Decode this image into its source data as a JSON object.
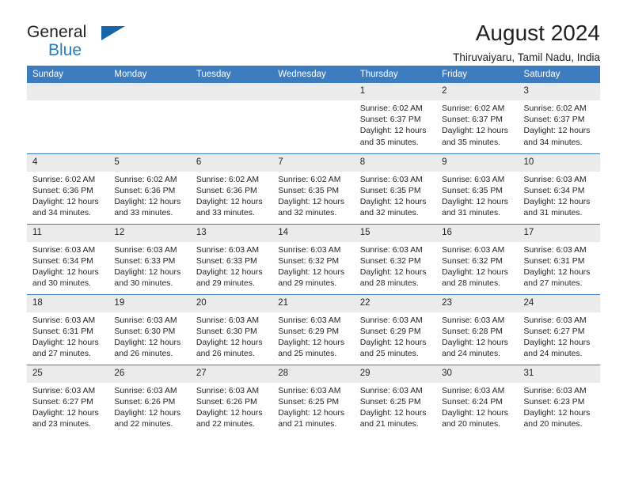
{
  "brand": {
    "name_part1": "General",
    "name_part2": "Blue",
    "flag_icon": "triangle-flag-icon"
  },
  "header": {
    "title": "August 2024",
    "location": "Thiruvaiyaru, Tamil Nadu, India"
  },
  "theme": {
    "header_blue": "#3c7cbf",
    "brand_blue": "#1f7fc4",
    "daynum_gray": "#ebebeb",
    "text": "#231f20"
  },
  "weekday_headers": [
    "Sunday",
    "Monday",
    "Tuesday",
    "Wednesday",
    "Thursday",
    "Friday",
    "Saturday"
  ],
  "weeks": [
    [
      {
        "day": "",
        "blank": true,
        "sunrise": "",
        "sunset": "",
        "daylight1": "",
        "daylight2": ""
      },
      {
        "day": "",
        "blank": true,
        "sunrise": "",
        "sunset": "",
        "daylight1": "",
        "daylight2": ""
      },
      {
        "day": "",
        "blank": true,
        "sunrise": "",
        "sunset": "",
        "daylight1": "",
        "daylight2": ""
      },
      {
        "day": "",
        "blank": true,
        "sunrise": "",
        "sunset": "",
        "daylight1": "",
        "daylight2": ""
      },
      {
        "day": "1",
        "blank": false,
        "sunrise": "Sunrise: 6:02 AM",
        "sunset": "Sunset: 6:37 PM",
        "daylight1": "Daylight: 12 hours",
        "daylight2": "and 35 minutes."
      },
      {
        "day": "2",
        "blank": false,
        "sunrise": "Sunrise: 6:02 AM",
        "sunset": "Sunset: 6:37 PM",
        "daylight1": "Daylight: 12 hours",
        "daylight2": "and 35 minutes."
      },
      {
        "day": "3",
        "blank": false,
        "sunrise": "Sunrise: 6:02 AM",
        "sunset": "Sunset: 6:37 PM",
        "daylight1": "Daylight: 12 hours",
        "daylight2": "and 34 minutes."
      }
    ],
    [
      {
        "day": "4",
        "blank": false,
        "sunrise": "Sunrise: 6:02 AM",
        "sunset": "Sunset: 6:36 PM",
        "daylight1": "Daylight: 12 hours",
        "daylight2": "and 34 minutes."
      },
      {
        "day": "5",
        "blank": false,
        "sunrise": "Sunrise: 6:02 AM",
        "sunset": "Sunset: 6:36 PM",
        "daylight1": "Daylight: 12 hours",
        "daylight2": "and 33 minutes."
      },
      {
        "day": "6",
        "blank": false,
        "sunrise": "Sunrise: 6:02 AM",
        "sunset": "Sunset: 6:36 PM",
        "daylight1": "Daylight: 12 hours",
        "daylight2": "and 33 minutes."
      },
      {
        "day": "7",
        "blank": false,
        "sunrise": "Sunrise: 6:02 AM",
        "sunset": "Sunset: 6:35 PM",
        "daylight1": "Daylight: 12 hours",
        "daylight2": "and 32 minutes."
      },
      {
        "day": "8",
        "blank": false,
        "sunrise": "Sunrise: 6:03 AM",
        "sunset": "Sunset: 6:35 PM",
        "daylight1": "Daylight: 12 hours",
        "daylight2": "and 32 minutes."
      },
      {
        "day": "9",
        "blank": false,
        "sunrise": "Sunrise: 6:03 AM",
        "sunset": "Sunset: 6:35 PM",
        "daylight1": "Daylight: 12 hours",
        "daylight2": "and 31 minutes."
      },
      {
        "day": "10",
        "blank": false,
        "sunrise": "Sunrise: 6:03 AM",
        "sunset": "Sunset: 6:34 PM",
        "daylight1": "Daylight: 12 hours",
        "daylight2": "and 31 minutes."
      }
    ],
    [
      {
        "day": "11",
        "blank": false,
        "sunrise": "Sunrise: 6:03 AM",
        "sunset": "Sunset: 6:34 PM",
        "daylight1": "Daylight: 12 hours",
        "daylight2": "and 30 minutes."
      },
      {
        "day": "12",
        "blank": false,
        "sunrise": "Sunrise: 6:03 AM",
        "sunset": "Sunset: 6:33 PM",
        "daylight1": "Daylight: 12 hours",
        "daylight2": "and 30 minutes."
      },
      {
        "day": "13",
        "blank": false,
        "sunrise": "Sunrise: 6:03 AM",
        "sunset": "Sunset: 6:33 PM",
        "daylight1": "Daylight: 12 hours",
        "daylight2": "and 29 minutes."
      },
      {
        "day": "14",
        "blank": false,
        "sunrise": "Sunrise: 6:03 AM",
        "sunset": "Sunset: 6:32 PM",
        "daylight1": "Daylight: 12 hours",
        "daylight2": "and 29 minutes."
      },
      {
        "day": "15",
        "blank": false,
        "sunrise": "Sunrise: 6:03 AM",
        "sunset": "Sunset: 6:32 PM",
        "daylight1": "Daylight: 12 hours",
        "daylight2": "and 28 minutes."
      },
      {
        "day": "16",
        "blank": false,
        "sunrise": "Sunrise: 6:03 AM",
        "sunset": "Sunset: 6:32 PM",
        "daylight1": "Daylight: 12 hours",
        "daylight2": "and 28 minutes."
      },
      {
        "day": "17",
        "blank": false,
        "sunrise": "Sunrise: 6:03 AM",
        "sunset": "Sunset: 6:31 PM",
        "daylight1": "Daylight: 12 hours",
        "daylight2": "and 27 minutes."
      }
    ],
    [
      {
        "day": "18",
        "blank": false,
        "sunrise": "Sunrise: 6:03 AM",
        "sunset": "Sunset: 6:31 PM",
        "daylight1": "Daylight: 12 hours",
        "daylight2": "and 27 minutes."
      },
      {
        "day": "19",
        "blank": false,
        "sunrise": "Sunrise: 6:03 AM",
        "sunset": "Sunset: 6:30 PM",
        "daylight1": "Daylight: 12 hours",
        "daylight2": "and 26 minutes."
      },
      {
        "day": "20",
        "blank": false,
        "sunrise": "Sunrise: 6:03 AM",
        "sunset": "Sunset: 6:30 PM",
        "daylight1": "Daylight: 12 hours",
        "daylight2": "and 26 minutes."
      },
      {
        "day": "21",
        "blank": false,
        "sunrise": "Sunrise: 6:03 AM",
        "sunset": "Sunset: 6:29 PM",
        "daylight1": "Daylight: 12 hours",
        "daylight2": "and 25 minutes."
      },
      {
        "day": "22",
        "blank": false,
        "sunrise": "Sunrise: 6:03 AM",
        "sunset": "Sunset: 6:29 PM",
        "daylight1": "Daylight: 12 hours",
        "daylight2": "and 25 minutes."
      },
      {
        "day": "23",
        "blank": false,
        "sunrise": "Sunrise: 6:03 AM",
        "sunset": "Sunset: 6:28 PM",
        "daylight1": "Daylight: 12 hours",
        "daylight2": "and 24 minutes."
      },
      {
        "day": "24",
        "blank": false,
        "sunrise": "Sunrise: 6:03 AM",
        "sunset": "Sunset: 6:27 PM",
        "daylight1": "Daylight: 12 hours",
        "daylight2": "and 24 minutes."
      }
    ],
    [
      {
        "day": "25",
        "blank": false,
        "sunrise": "Sunrise: 6:03 AM",
        "sunset": "Sunset: 6:27 PM",
        "daylight1": "Daylight: 12 hours",
        "daylight2": "and 23 minutes."
      },
      {
        "day": "26",
        "blank": false,
        "sunrise": "Sunrise: 6:03 AM",
        "sunset": "Sunset: 6:26 PM",
        "daylight1": "Daylight: 12 hours",
        "daylight2": "and 22 minutes."
      },
      {
        "day": "27",
        "blank": false,
        "sunrise": "Sunrise: 6:03 AM",
        "sunset": "Sunset: 6:26 PM",
        "daylight1": "Daylight: 12 hours",
        "daylight2": "and 22 minutes."
      },
      {
        "day": "28",
        "blank": false,
        "sunrise": "Sunrise: 6:03 AM",
        "sunset": "Sunset: 6:25 PM",
        "daylight1": "Daylight: 12 hours",
        "daylight2": "and 21 minutes."
      },
      {
        "day": "29",
        "blank": false,
        "sunrise": "Sunrise: 6:03 AM",
        "sunset": "Sunset: 6:25 PM",
        "daylight1": "Daylight: 12 hours",
        "daylight2": "and 21 minutes."
      },
      {
        "day": "30",
        "blank": false,
        "sunrise": "Sunrise: 6:03 AM",
        "sunset": "Sunset: 6:24 PM",
        "daylight1": "Daylight: 12 hours",
        "daylight2": "and 20 minutes."
      },
      {
        "day": "31",
        "blank": false,
        "sunrise": "Sunrise: 6:03 AM",
        "sunset": "Sunset: 6:23 PM",
        "daylight1": "Daylight: 12 hours",
        "daylight2": "and 20 minutes."
      }
    ]
  ]
}
